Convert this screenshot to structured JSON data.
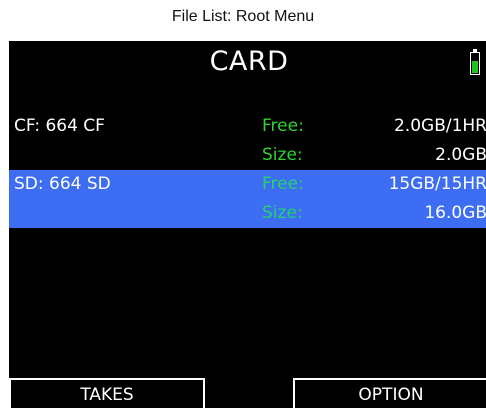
{
  "caption": "File List: Root Menu",
  "screen": {
    "title": "CARD",
    "battery": {
      "icon": "battery-icon",
      "level": 0.6,
      "color": "#1ec51e"
    },
    "cards": [
      {
        "name": "CF: 664 CF",
        "free_label": "Free:",
        "free_value": "2.0GB/1HR",
        "size_label": "Size:",
        "size_value": "2.0GB",
        "selected": false
      },
      {
        "name": "SD: 664 SD",
        "free_label": "Free:",
        "free_value": "15GB/15HR",
        "size_label": "Size:",
        "size_value": "16.0GB",
        "selected": true
      }
    ],
    "softkeys": {
      "left": "TAKES",
      "right": "OPTION"
    },
    "colors": {
      "background": "#000000",
      "selection": "#3d6df2",
      "label": "#2fd42f",
      "text": "#ffffff"
    }
  }
}
